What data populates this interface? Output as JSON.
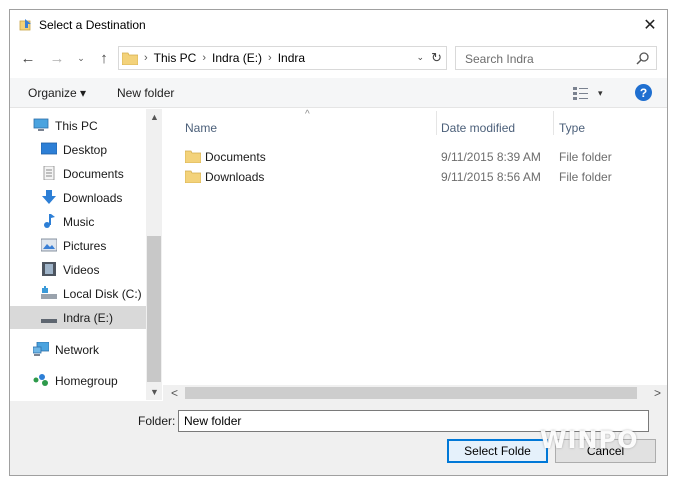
{
  "window": {
    "title": "Select a Destination",
    "close_glyph": "✕"
  },
  "nav": {
    "back_glyph": "←",
    "forward_glyph": "→",
    "recent_glyph": "⌄",
    "up_glyph": "↑",
    "breadcrumbs": [
      "This PC",
      "Indra (E:)",
      "Indra"
    ],
    "breadcrumb_sep": "›",
    "dropdown_glyph": "⌄",
    "refresh_glyph": "↻"
  },
  "search": {
    "placeholder": "Search Indra"
  },
  "toolbar": {
    "organize_label": "Organize ▾",
    "new_folder_label": "New folder",
    "view_dropdown_glyph": "▾",
    "help_label": "?"
  },
  "navigation_pane": {
    "items": [
      {
        "label": "This PC",
        "icon": "computer-icon"
      },
      {
        "label": "Desktop",
        "icon": "desktop-icon"
      },
      {
        "label": "Documents",
        "icon": "documents-icon"
      },
      {
        "label": "Downloads",
        "icon": "downloads-icon"
      },
      {
        "label": "Music",
        "icon": "music-icon"
      },
      {
        "label": "Pictures",
        "icon": "pictures-icon"
      },
      {
        "label": "Videos",
        "icon": "videos-icon"
      },
      {
        "label": "Local Disk (C:)",
        "icon": "local-disk-icon"
      },
      {
        "label": "Indra (E:)",
        "icon": "drive-icon",
        "selected": true
      },
      {
        "label": "Network",
        "icon": "network-icon"
      },
      {
        "label": "Homegroup",
        "icon": "homegroup-icon"
      }
    ],
    "scroll_up_glyph": "▲",
    "scroll_down_glyph": "▼"
  },
  "file_list": {
    "columns": [
      "Name",
      "Date modified",
      "Type"
    ],
    "sort_glyph": "^",
    "rows": [
      {
        "name": "Documents",
        "date": "9/11/2015 8:39 AM",
        "type": "File folder"
      },
      {
        "name": "Downloads",
        "date": "9/11/2015 8:56 AM",
        "type": "File folder"
      }
    ],
    "scroll_left_glyph": "<",
    "scroll_right_glyph": ">"
  },
  "footer": {
    "folder_label": "Folder:",
    "folder_value": "New folder",
    "select_button": "Select Folde",
    "cancel_button": "Cancel"
  },
  "watermark": "WINPO",
  "colors": {
    "accent": "#0078d7",
    "help": "#1f6fd0",
    "folder": "#f3d27a",
    "header_text": "#4c607a"
  }
}
